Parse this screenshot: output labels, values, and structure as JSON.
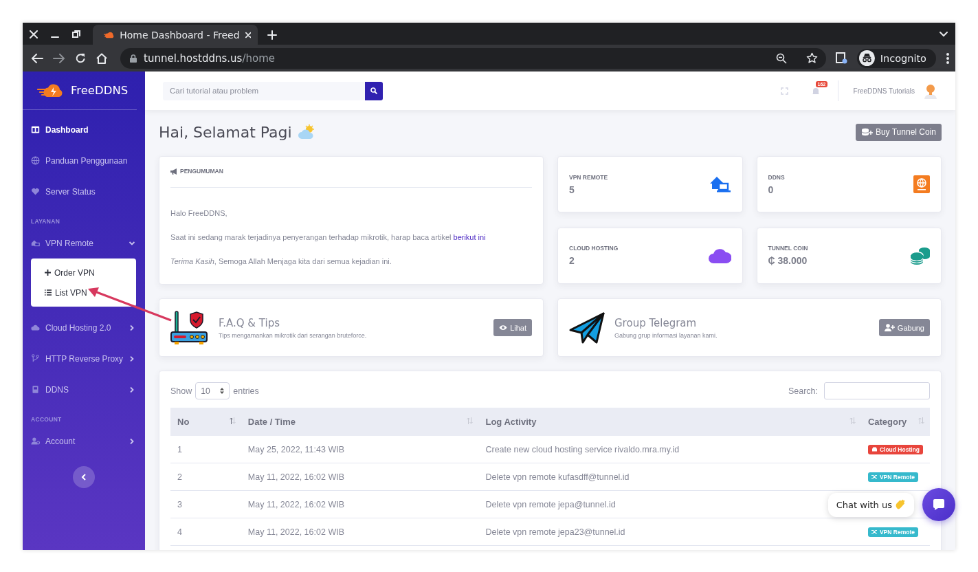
{
  "browser": {
    "tabs": [
      {
        "title": "Home Dashboard - Freed",
        "selected": true
      }
    ],
    "url_host": "tunnel.hostddns.us",
    "url_path": "/home",
    "profile": "Incognito"
  },
  "sidebar": {
    "brand": "FreeDDNS",
    "items": [
      {
        "kind": "link",
        "label": "Dashboard",
        "selected": true
      },
      {
        "kind": "link",
        "label": "Panduan Penggunaan",
        "selected": false
      },
      {
        "kind": "link",
        "label": "Server Status",
        "selected": false
      },
      {
        "kind": "header",
        "label": "LAYANAN"
      },
      {
        "kind": "group",
        "label": "VPN Remote",
        "expanded": true,
        "selected": false,
        "children": [
          {
            "label": "Order VPN",
            "selected": false
          },
          {
            "label": "List VPN",
            "selected": false
          }
        ]
      },
      {
        "kind": "group",
        "label": "Cloud Hosting 2.0",
        "expanded": false,
        "selected": false
      },
      {
        "kind": "group",
        "label": "HTTP Reverse Proxy",
        "expanded": false,
        "selected": false
      },
      {
        "kind": "group",
        "label": "DDNS",
        "expanded": false,
        "selected": false
      },
      {
        "kind": "header",
        "label": "ACCOUNT"
      },
      {
        "kind": "group",
        "label": "Account",
        "expanded": false,
        "selected": false
      }
    ]
  },
  "topbar": {
    "search_placeholder": "Cari tutorial atau problem",
    "notifications": "162",
    "user": "FreeDDNS Tutorials"
  },
  "greeting": "Hai, Selamat Pagi",
  "buy_button": "Buy Tunnel Coin",
  "announcement": {
    "heading": "PENGUMUMAN",
    "paragraphs": [
      {
        "text": "Halo FreeDDNS,"
      },
      {
        "text": "Saat ini sedang marak terjadinya penyerangan terhadap mikrotik, harap baca artikel",
        "link": "berikut ini"
      },
      {
        "text": "*Terima Kasih*, Semoga Allah Menjaga kita dari semua kejadian ini."
      }
    ]
  },
  "stats": [
    {
      "label": "VPN REMOTE",
      "value": "5",
      "color": "#1a6ff0"
    },
    {
      "label": "DDNS",
      "value": "0",
      "color": "#f47c20"
    },
    {
      "label": "CLOUD HOSTING",
      "value": "2",
      "color": "#8a4df2"
    },
    {
      "label": "TUNNEL COIN",
      "value": "₵ 38.000",
      "color": "#1a9c8c"
    }
  ],
  "promos": [
    {
      "title": "F.A.Q & Tips",
      "subtitle": "Tips mengamankan mikrotik dari serangan bruteforce.",
      "button": "Lihat"
    },
    {
      "title": "Group Telegram",
      "subtitle": "Gabung grup informasi layanan kami.",
      "button": "Gabung"
    }
  ],
  "table": {
    "show_label": "Show",
    "page_size": "10",
    "entries_label": "entries",
    "search_label": "Search:",
    "columns": [
      {
        "label": "No",
        "sorted": true
      },
      {
        "label": "Date / Time",
        "sorted": false
      },
      {
        "label": "Log Activity",
        "sorted": false
      },
      {
        "label": "Category",
        "sorted": false
      }
    ],
    "rows": [
      {
        "no": "1",
        "date": "May 25, 2022, 11:43 WIB",
        "activity": "Create new cloud hosting service rivaldo.mra.my.id",
        "category": {
          "kind": "cloud",
          "label": "Cloud Hosting",
          "color": "#e8453c"
        }
      },
      {
        "no": "2",
        "date": "May 11, 2022, 16:02 WIB",
        "activity": "Delete vpn remote kufasdff@tunnel.id",
        "category": {
          "kind": "vpn",
          "label": "VPN Remote",
          "color": "#36b9cc"
        }
      },
      {
        "no": "3",
        "date": "May 11, 2022, 16:02 WIB",
        "activity": "Delete vpn remote jepa@tunnel.id"
      },
      {
        "no": "4",
        "date": "May 11, 2022, 16:02 WIB",
        "activity": "Delete vpn remote jepa23@tunnel.id",
        "category": {
          "kind": "vpn",
          "label": "VPN Remote",
          "color": "#36b9cc"
        }
      }
    ]
  },
  "chat": {
    "label": "Chat with us"
  }
}
